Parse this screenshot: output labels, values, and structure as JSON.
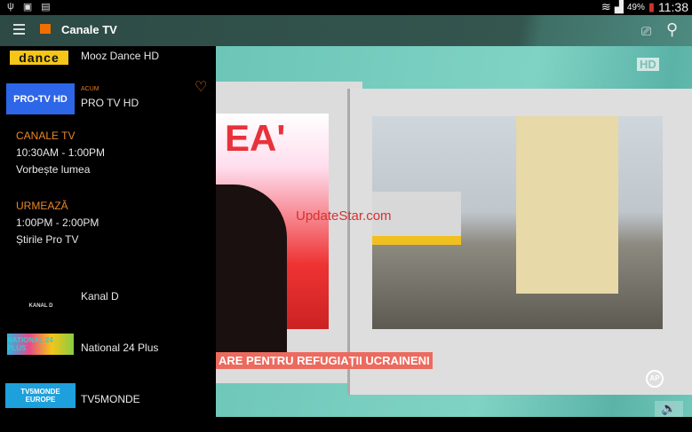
{
  "status_bar": {
    "battery": "49%",
    "time": "11:38",
    "icons": [
      "usb-icon",
      "image-icon",
      "sim-icon",
      "wifi-icon",
      "signal-icon",
      "battery-icon"
    ]
  },
  "toolbar": {
    "title": "Canale TV",
    "icons": [
      "menu-icon",
      "orange-logo",
      "cast-icon",
      "search-icon"
    ]
  },
  "channels": [
    {
      "logo": "dance",
      "name": "Mooz Dance HD"
    },
    {
      "logo": "PRO•TV HD",
      "name": "PRO TV HD",
      "badge": "ACUM"
    },
    {
      "logo": "KANAL D",
      "name": "Kanal D"
    },
    {
      "logo": "NATIONAL 24 PLUS",
      "name": "National 24 Plus"
    },
    {
      "logo": "TV5MONDE EUROPE",
      "name": "TV5MONDE"
    }
  ],
  "now": {
    "heading": "CANALE TV",
    "time": "10:30AM - 1:00PM",
    "show": "Vorbește lumea"
  },
  "next": {
    "heading": "URMEAZĂ",
    "time": "1:00PM - 2:00PM",
    "show": "Știrile Pro TV"
  },
  "video": {
    "hd_badge": "HD",
    "studio_text": "EA'",
    "lower_third": "ARE PENTRU REFUGIAȚII UCRAINENI",
    "ap_badge": "AP",
    "watermark": "UpdateStar.com"
  }
}
